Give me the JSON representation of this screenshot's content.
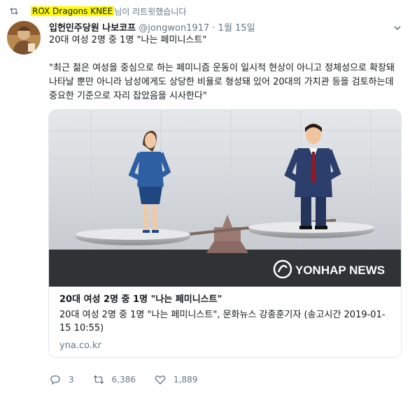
{
  "retweet": {
    "icon": "retweet-icon",
    "retweeter": "ROX Dragons KNEE",
    "suffix": " 님이 리트윗했습니다"
  },
  "tweet": {
    "author_name": "입헌민주당원 나보코프",
    "handle": "@jongwon1917",
    "separator": "·",
    "date": "1월 15일",
    "line1": "20대 여성 2명 중 1명 \"나는 페미니스트\"",
    "quote": "\"최근 젊은 여성을 중심으로 하는 페미니즘 운동이 일시적 현상이 아니고 정체성으로 확장돼 나타날 뿐만 아니라 남성에게도 상당한 비율로 형성돼 있어 20대의 가치관 등을 검토하는데 중요한 기준으로 자리 잡았음을 시사한다\""
  },
  "card": {
    "watermark": "YONHAP NEWS",
    "title": "20대 여성 2명 중 1명 \"나는 페미니스트\"",
    "description": "20대 여성 2명 중 1명 \"나는 페미니스트\", 문화뉴스 강종훈기자 (송고시간 2019-01-15 10:55)",
    "domain": "yna.co.kr"
  },
  "actions": {
    "reply_icon": "reply-icon",
    "reply_count": "3",
    "retweet_icon": "retweet-icon",
    "retweet_count": "6,386",
    "like_icon": "heart-icon",
    "like_count": "1,889"
  },
  "colors": {
    "highlight": "#fffb00",
    "secondary_text": "#657786",
    "card_border": "#e1e8ed"
  }
}
